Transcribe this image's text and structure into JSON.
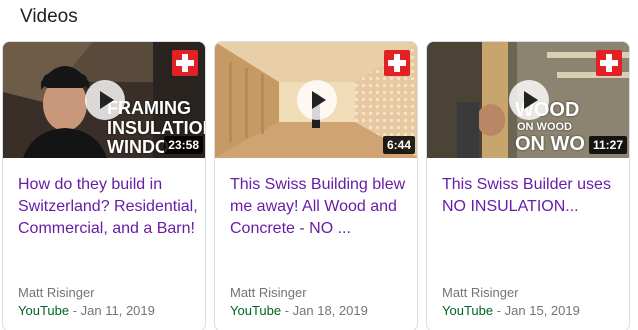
{
  "section": {
    "title": "Videos"
  },
  "videos": [
    {
      "title": "How do they build in Switzerland? Residential, Commercial, and a Barn!",
      "author": "Matt Risinger",
      "source": "YouTube",
      "date_sep": " - ",
      "date": "Jan 11, 2019",
      "duration": "23:58",
      "overlay": [
        "FRAMING",
        "INSULATION",
        "WINDO"
      ]
    },
    {
      "title": "This Swiss Building blew me away! All Wood and Concrete - NO ...",
      "author": "Matt Risinger",
      "source": "YouTube",
      "date_sep": " - ",
      "date": "Jan 18, 2019",
      "duration": "6:44"
    },
    {
      "title": "This Swiss Builder uses NO INSULATION...",
      "author": "Matt Risinger",
      "source": "YouTube",
      "date_sep": " - ",
      "date": "Jan 15, 2019",
      "duration": "11:27",
      "overlay": [
        "WOOD",
        "ON WOOD",
        "ON WO"
      ]
    }
  ],
  "colors": {
    "title_visited": "#681da8",
    "source_green": "#006621",
    "swiss_red": "#e32125"
  },
  "icons": [
    "play-icon",
    "swiss-flag-icon"
  ]
}
